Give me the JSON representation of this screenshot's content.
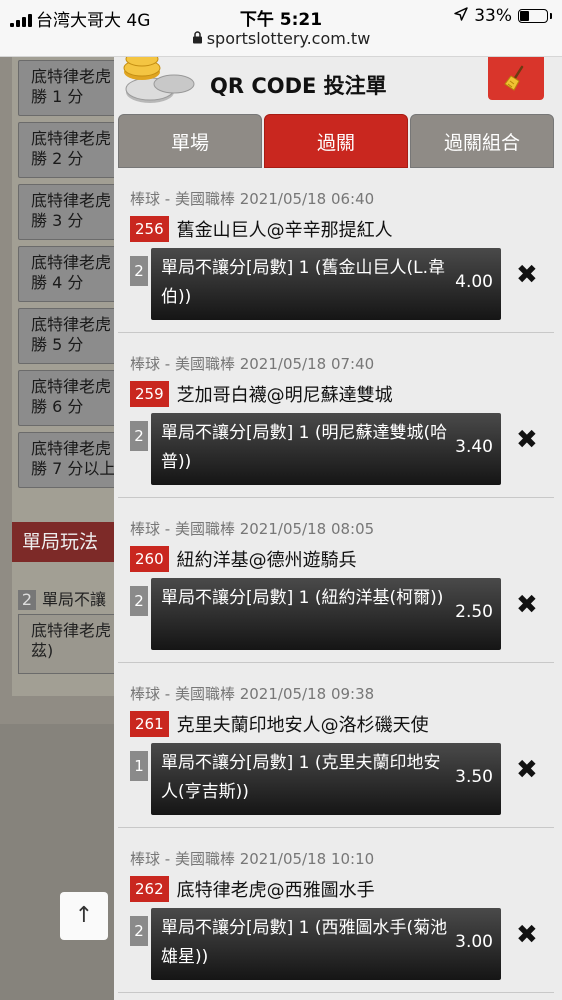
{
  "status_bar": {
    "carrier": "台湾大哥大  4G",
    "time": "下午 5:21",
    "battery": "33%",
    "battery_level": 0.33,
    "url": "sportslottery.com.tw"
  },
  "background": {
    "rows": [
      [
        "底特律老虎",
        "勝 1 分"
      ],
      [
        "底特律老虎",
        "勝 2 分"
      ],
      [
        "底特律老虎",
        "勝 3 分"
      ],
      [
        "底特律老虎",
        "勝 4 分"
      ],
      [
        "底特律老虎",
        "勝 5 分"
      ],
      [
        "底特律老虎",
        "勝 6 分"
      ],
      [
        "底特律老虎",
        "勝 7 分以上"
      ]
    ],
    "section_title": "單局玩法",
    "section_num": "2",
    "section_label": "單局不讓",
    "item_line1": "底特律老虎",
    "item_line2": "茲)"
  },
  "modal": {
    "title": "QR CODE 投注單",
    "tabs": [
      "單場",
      "過關",
      "過關組合"
    ],
    "active_tab": 1,
    "remove_symbol": "✖",
    "bets": [
      {
        "meta": "棒球 - 美國職棒 2021/05/18 06:40",
        "code": "256",
        "match": "舊金山巨人@辛辛那提紅人",
        "count": "2",
        "selection": "單局不讓分[局數] 1 (舊金山巨人(L.韋伯))",
        "odds": "4.00"
      },
      {
        "meta": "棒球 - 美國職棒 2021/05/18 07:40",
        "code": "259",
        "match": "芝加哥白襪@明尼蘇達雙城",
        "count": "2",
        "selection": "單局不讓分[局數] 1 (明尼蘇達雙城(哈普))",
        "odds": "3.40"
      },
      {
        "meta": "棒球 - 美國職棒 2021/05/18 08:05",
        "code": "260",
        "match": "紐約洋基@德州遊騎兵",
        "count": "2",
        "selection": "單局不讓分[局數] 1 (紐約洋基(柯爾))",
        "odds": "2.50"
      },
      {
        "meta": "棒球 - 美國職棒 2021/05/18 09:38",
        "code": "261",
        "match": "克里夫蘭印地安人@洛杉磯天使",
        "count": "1",
        "selection": "單局不讓分[局數] 1 (克里夫蘭印地安人(亨吉斯))",
        "odds": "3.50"
      },
      {
        "meta": "棒球 - 美國職棒 2021/05/18 10:10",
        "code": "262",
        "match": "底特律老虎@西雅圖水手",
        "count": "2",
        "selection": "單局不讓分[局數] 1 (西雅圖水手(菊池雄星))",
        "odds": "3.00"
      }
    ]
  },
  "scroll_top_label": "↑"
}
